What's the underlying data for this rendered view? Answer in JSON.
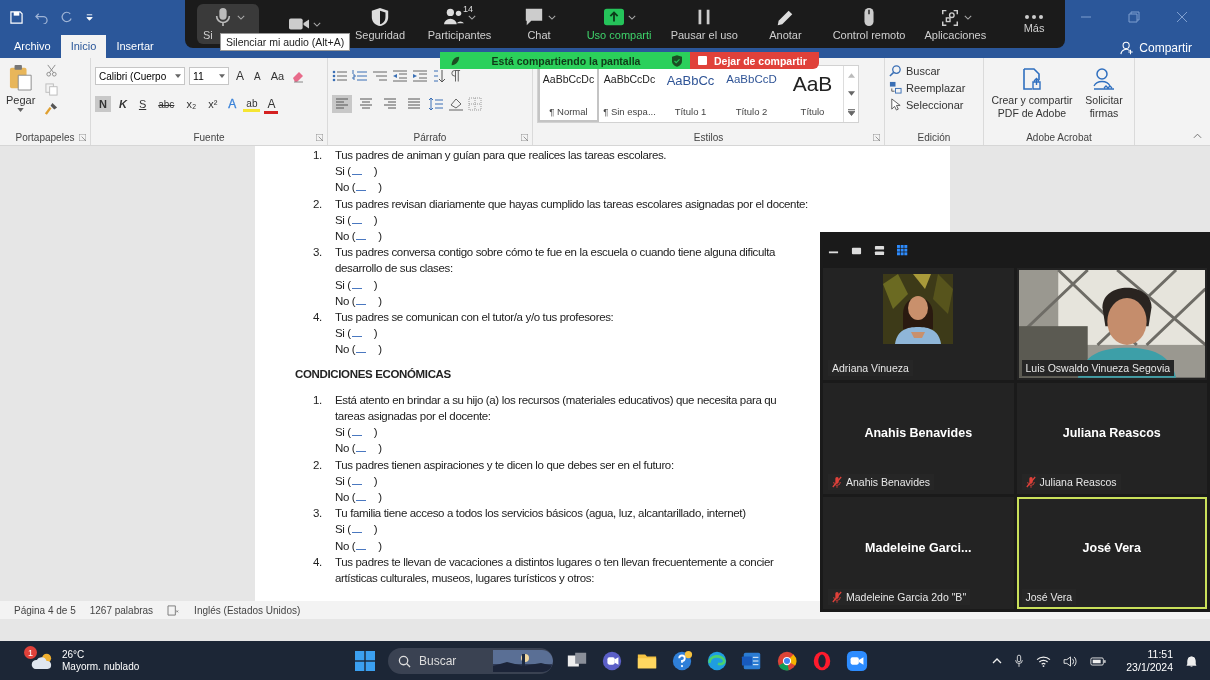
{
  "word": {
    "tabs": [
      {
        "label": "Archivo",
        "selected": false
      },
      {
        "label": "Inicio",
        "selected": true
      },
      {
        "label": "Insertar",
        "selected": false
      }
    ],
    "share_button": "Compartir",
    "ribbon": {
      "clipboard": {
        "paste": "Pegar",
        "label": "Portapapeles"
      },
      "font": {
        "name": "Calibri (Cuerpo",
        "size": "11",
        "tools": [
          {
            "kind": "grow",
            "label": "A"
          },
          {
            "kind": "shrink",
            "label": "A"
          },
          {
            "kind": "case",
            "label": "Aa"
          }
        ],
        "format": [
          {
            "label": "N",
            "selected": true
          },
          {
            "label": "K",
            "selected": false
          },
          {
            "label": "S",
            "selected": false
          },
          {
            "label": "abc",
            "selected": false
          },
          {
            "label": "x₂",
            "selected": false
          },
          {
            "label": "x²",
            "selected": false
          }
        ],
        "color_tools": [
          {
            "kind": "effects",
            "label": "A"
          },
          {
            "kind": "highlight",
            "label": "ab"
          },
          {
            "kind": "color",
            "label": "A"
          }
        ],
        "label": "Fuente"
      },
      "paragraph": {
        "label": "Párrafo",
        "alignments": [
          {
            "kind": "left",
            "selected": true
          },
          {
            "kind": "center",
            "selected": false
          },
          {
            "kind": "right",
            "selected": false
          },
          {
            "kind": "justify",
            "selected": false
          }
        ]
      },
      "styles": {
        "label": "Estilos",
        "items": [
          {
            "kind": "normal",
            "preview": "AaBbCcDc",
            "name": "¶ Normal",
            "selected": true
          },
          {
            "kind": "normal",
            "preview": "AaBbCcDc",
            "name": "¶ Sin espa...",
            "selected": false
          },
          {
            "kind": "heading1",
            "preview": "AaBbCc",
            "name": "Título 1",
            "selected": false
          },
          {
            "kind": "heading2",
            "preview": "AaBbCcD",
            "name": "Título 2",
            "selected": false
          },
          {
            "kind": "title",
            "preview": "AaB",
            "name": "Título",
            "selected": false
          }
        ]
      },
      "editing": {
        "label": "Edición",
        "items": [
          {
            "kind": "find",
            "label": "Buscar"
          },
          {
            "kind": "replace",
            "label": "Reemplazar"
          },
          {
            "kind": "select",
            "label": "Seleccionar"
          }
        ]
      },
      "acrobat": {
        "label": "Adobe Acrobat",
        "items": [
          {
            "kind": "pdf",
            "label": "Crear y compartir PDF de Adobe"
          },
          {
            "kind": "sign",
            "label": "Solicitar firmas"
          }
        ]
      }
    },
    "document": {
      "blocks": [
        {
          "kind": "question",
          "number": "1.",
          "lines": [
            "Tus padres de animan y guían para que realices las tareas escolares."
          ],
          "options": [
            {
              "prefix": "Si (",
              "suffix": ")"
            },
            {
              "prefix": "No (",
              "suffix": ")"
            }
          ]
        },
        {
          "kind": "question",
          "number": "2.",
          "lines": [
            "Tus padres revisan diariamente que hayas cumplido las tareas escolares asignadas por el docente:"
          ],
          "options": [
            {
              "prefix": "Si (",
              "suffix": ")"
            },
            {
              "prefix": "No (",
              "suffix": ")"
            }
          ]
        },
        {
          "kind": "question",
          "number": "3.",
          "lines": [
            "Tus padres conversa contigo sobre cómo te fue en la escuela o cuando tiene alguna dificulta",
            "desarrollo de sus clases:"
          ],
          "options": [
            {
              "prefix": "Si (",
              "suffix": ")"
            },
            {
              "prefix": "No (",
              "suffix": ")"
            }
          ]
        },
        {
          "kind": "question",
          "number": "4.",
          "lines": [
            "Tus padres se comunican con el tutor/a y/o tus profesores:"
          ],
          "options": [
            {
              "prefix": "Si (",
              "suffix": ")"
            },
            {
              "prefix": "No (",
              "suffix": ")"
            }
          ]
        },
        {
          "kind": "heading",
          "text": "CONDICIONES ECONÓMICAS"
        },
        {
          "kind": "question",
          "number": "1.",
          "lines": [
            "Está atento en brindar a su hijo (a) los recursos (materiales educativos) que necesita para qu",
            "tareas asignadas por el docente:"
          ],
          "options": [
            {
              "prefix": "Si (",
              "suffix": ")"
            },
            {
              "prefix": "No (",
              "suffix": ")"
            }
          ]
        },
        {
          "kind": "question",
          "number": "2.",
          "lines": [
            "Tus padres tienen aspiraciones y te dicen lo que debes ser en el futuro:"
          ],
          "options": [
            {
              "prefix": "Si (",
              "suffix": ")"
            },
            {
              "prefix": "No (",
              "suffix": ")"
            }
          ]
        },
        {
          "kind": "question",
          "number": "3.",
          "lines": [
            "Tu familia tiene acceso a todos los servicios básicos (agua, luz, alcantarillado, internet)"
          ],
          "options": [
            {
              "prefix": "Si (",
              "suffix": ")"
            },
            {
              "prefix": "No (",
              "suffix": ")"
            }
          ]
        },
        {
          "kind": "question",
          "number": "4.",
          "lines": [
            "Tus padres te llevan de vacaciones a distintos lugares o ten llevan frecuentemente a concier",
            "artísticas culturales, museos, lugares turísticos y otros:"
          ]
        }
      ]
    },
    "status_bar": {
      "page": "Página 4 de 5",
      "words": "1267 palabras",
      "language": "Inglés (Estados Unidos)"
    }
  },
  "zoom": {
    "toolbar": [
      {
        "kind": "mic",
        "label": "Si",
        "caret": true,
        "hovered": true
      },
      {
        "kind": "video",
        "caret": true,
        "hovered": false
      },
      {
        "kind": "security",
        "label": "Seguridad",
        "caret": false,
        "hovered": false
      },
      {
        "kind": "participants",
        "label": "Participantes",
        "badge": "14",
        "caret": true,
        "hovered": false
      },
      {
        "kind": "chat",
        "label": "Chat",
        "caret": true,
        "hovered": false
      },
      {
        "kind": "share",
        "label": "Uso comparti",
        "caret": true,
        "hovered": false
      },
      {
        "kind": "pause",
        "label": "Pausar el uso",
        "caret": false,
        "hovered": false
      },
      {
        "kind": "annotate",
        "label": "Anotar",
        "caret": false,
        "hovered": false
      },
      {
        "kind": "remote",
        "label": "Control remoto",
        "caret": false,
        "hovered": false
      },
      {
        "kind": "apps",
        "label": "Aplicaciones",
        "caret": true,
        "hovered": false
      },
      {
        "kind": "more",
        "label": "Más",
        "caret": false,
        "hovered": false
      }
    ],
    "tooltip": "Silenciar mi audio (Alt+A)",
    "share_banner": {
      "status": "Está compartiendo la pantalla",
      "stop": "Dejar de compartir"
    },
    "gallery": {
      "views": [
        {
          "kind": "single",
          "selected": false
        },
        {
          "kind": "speaker",
          "selected": false
        },
        {
          "kind": "gallery",
          "selected": true
        }
      ],
      "participants": [
        {
          "label": "Adriana Vinueza",
          "muted": false,
          "speaking": false
        },
        {
          "kind": "video",
          "label": "Luis Oswaldo Vinueza Segovia",
          "muted": false,
          "speaking": false
        },
        {
          "kind": "name",
          "name": "Anahis Benavides",
          "label": "Anahis Benavides",
          "muted": true,
          "speaking": false
        },
        {
          "kind": "name",
          "name": "Juliana Reascos",
          "label": "Juliana Reascos",
          "muted": true,
          "speaking": false
        },
        {
          "kind": "name",
          "name": "Madeleine Garci...",
          "label": "Madeleine Garcia 2do \"B\"",
          "muted": true,
          "speaking": false
        },
        {
          "kind": "name",
          "name": "José Vera",
          "label": "José Vera",
          "muted": false,
          "speaking": true
        }
      ]
    }
  },
  "taskbar": {
    "weather": {
      "badge": "1",
      "temperature": "26°C",
      "condition": "Mayorm. nublado"
    },
    "search": {
      "placeholder": "Buscar"
    },
    "apps": [
      {
        "kind": "task-view"
      },
      {
        "kind": "meet"
      },
      {
        "kind": "files"
      },
      {
        "kind": "help"
      },
      {
        "kind": "edge"
      },
      {
        "kind": "word"
      },
      {
        "kind": "chrome"
      },
      {
        "kind": "opera"
      },
      {
        "kind": "zoom"
      }
    ],
    "time": "11:51",
    "date": "23/1/2024"
  }
}
